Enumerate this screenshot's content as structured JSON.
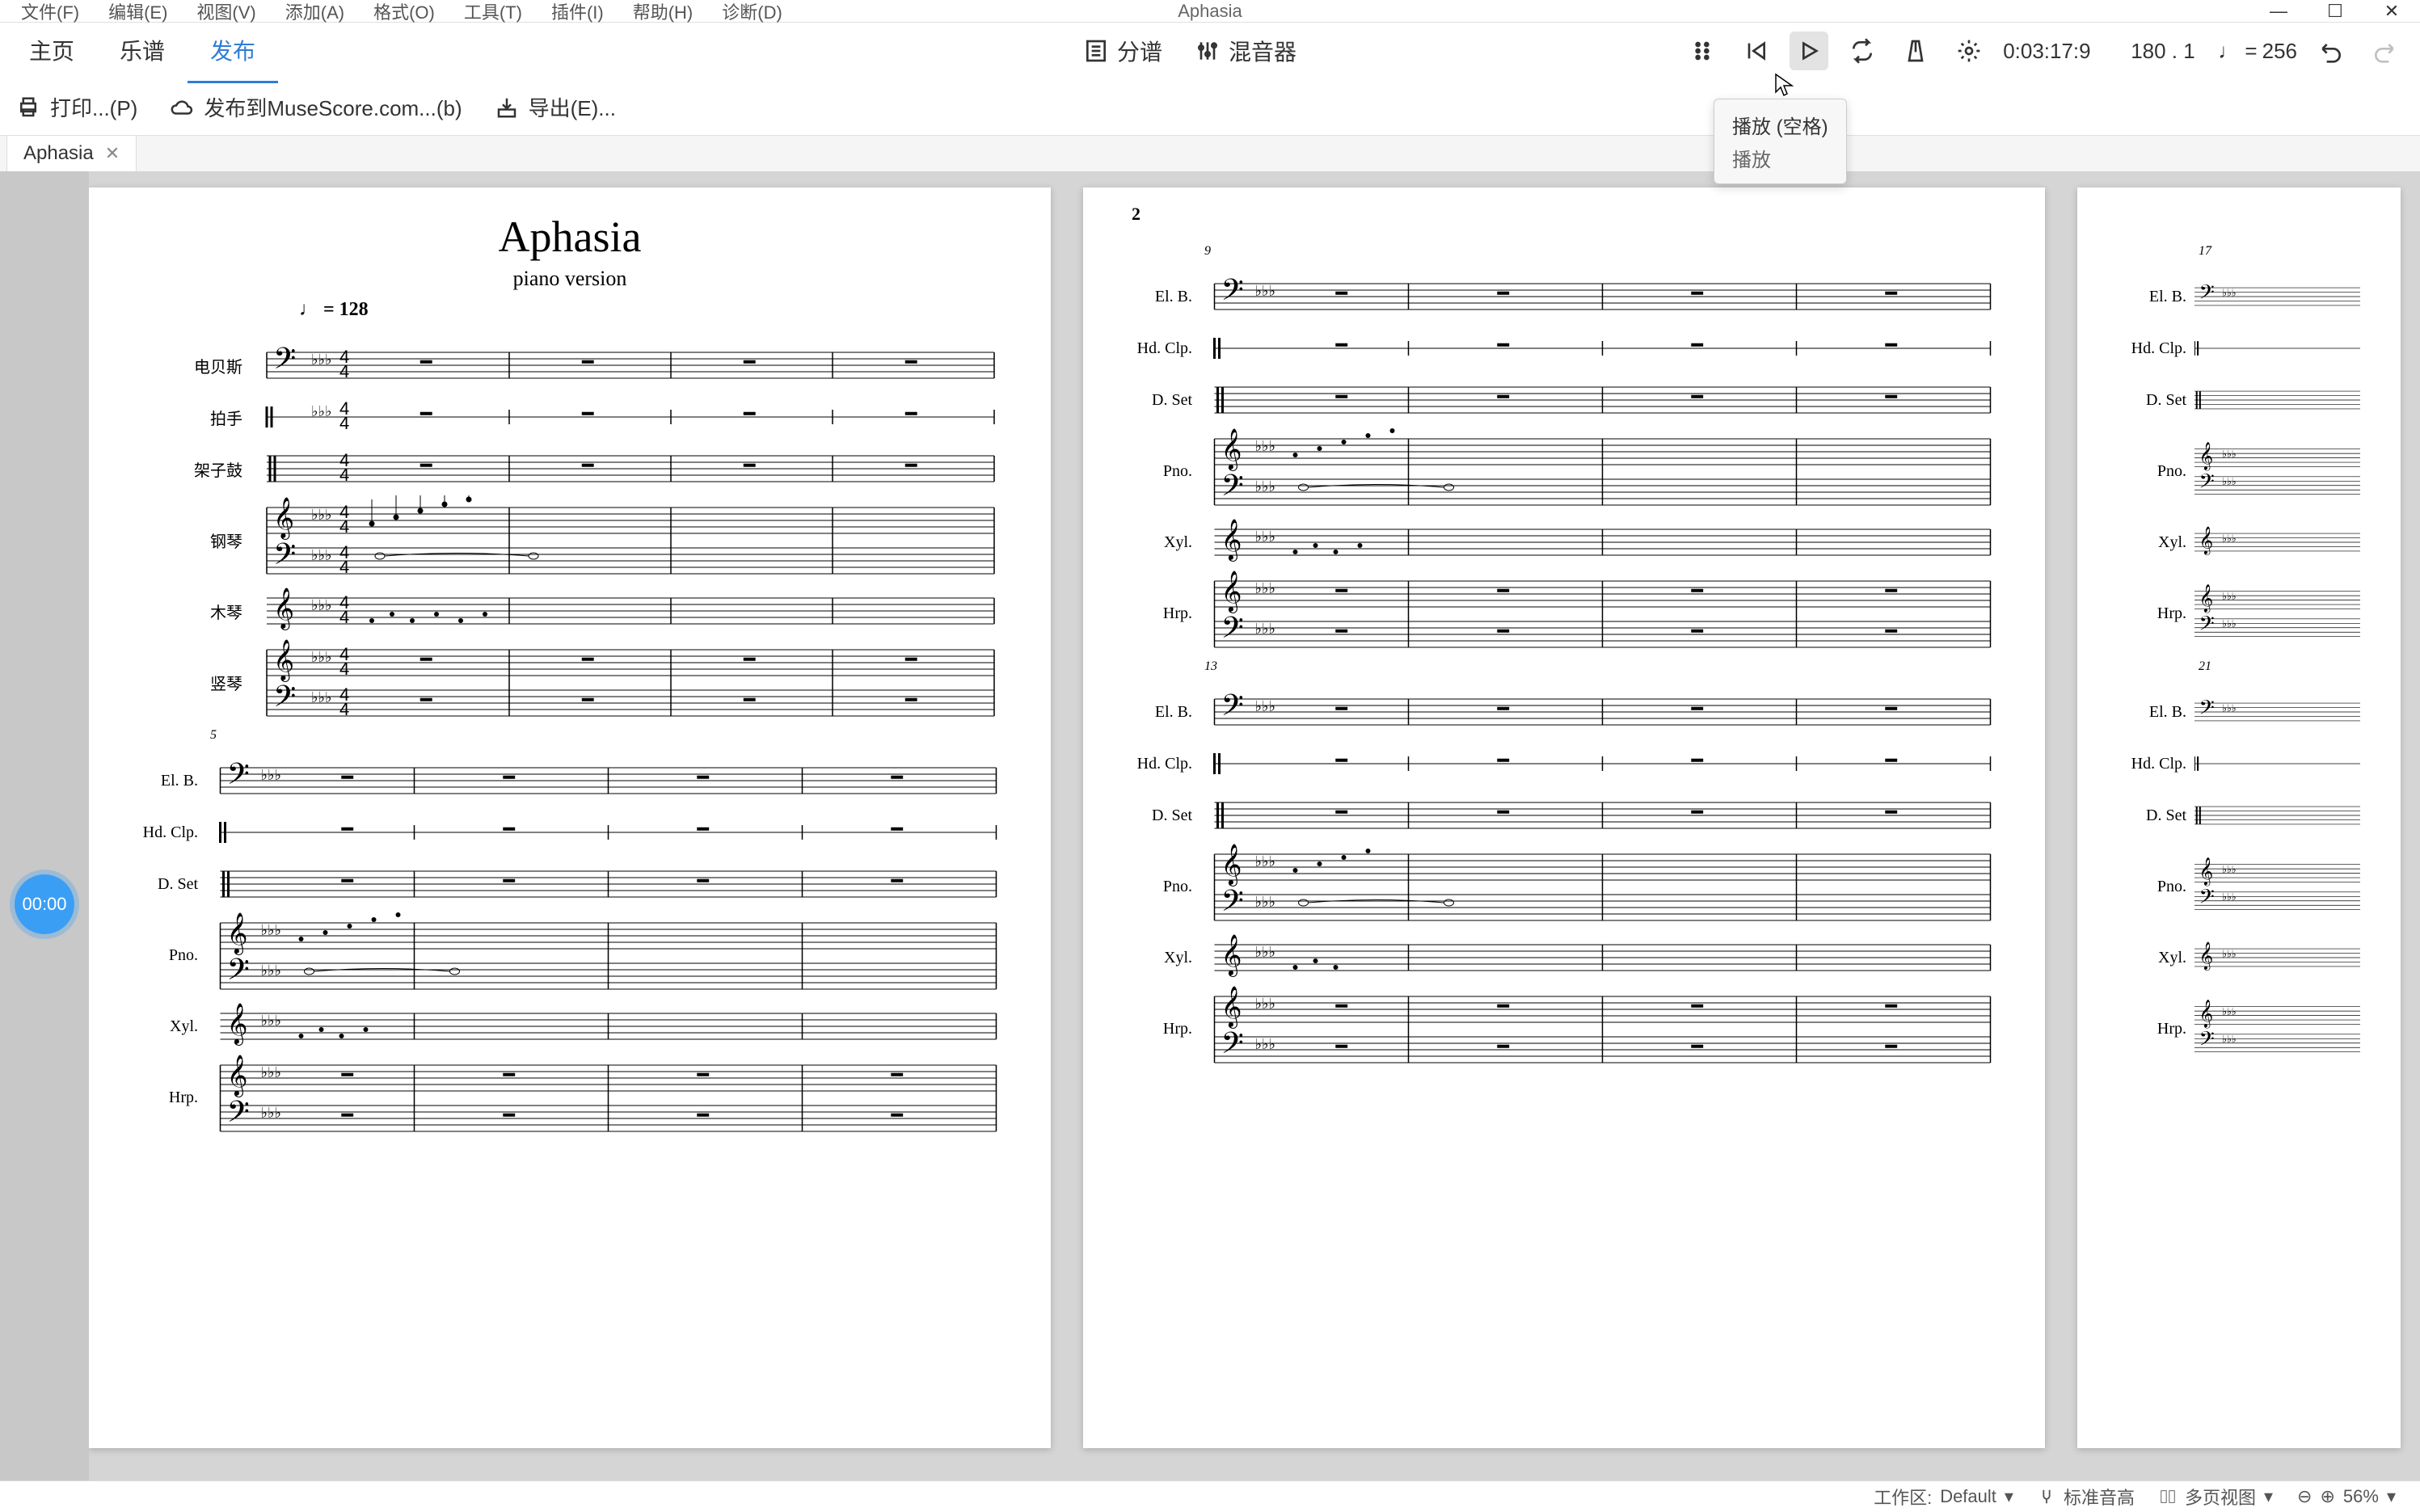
{
  "app_title": "Aphasia",
  "menubar": [
    "文件(F)",
    "编辑(E)",
    "视图(V)",
    "添加(A)",
    "格式(O)",
    "工具(T)",
    "插件(I)",
    "帮助(H)",
    "诊断(D)"
  ],
  "main_tabs": {
    "home": "主页",
    "score": "乐谱",
    "publish": "发布",
    "active": "publish"
  },
  "center_tools": {
    "parts": "分谱",
    "mixer": "混音器"
  },
  "playback": {
    "time": "0:03:17:9",
    "measure": "180 . 1",
    "tempo_value": "256",
    "tempo_prefix": "♩ = "
  },
  "toolbar": {
    "print": "打印...(P)",
    "publish": "发布到MuseScore.com...(b)",
    "export": "导出(E)..."
  },
  "tooltip": {
    "line1": "播放 (空格)",
    "line2": "播放"
  },
  "doctab": {
    "name": "Aphasia"
  },
  "timer_badge": "00:00",
  "score": {
    "title": "Aphasia",
    "subtitle": "piano version",
    "tempo_marking": "♩ = 128",
    "page1_instruments": [
      "电贝斯",
      "拍手",
      "架子鼓",
      "钢琴",
      "木琴",
      "竖琴"
    ],
    "short_labels": [
      "El. B.",
      "Hd. Clp.",
      "D. Set",
      "Pno.",
      "Xyl.",
      "Hrp."
    ],
    "page2_number": "2",
    "measure_numbers": {
      "sys2": "5",
      "p2_sys1": "9",
      "p2_sys2": "13",
      "p3_sys1": "17",
      "p3_sys2": "21"
    }
  },
  "statusbar": {
    "workspace_label": "工作区:",
    "workspace_value": "Default",
    "pitch": "标准音高",
    "view": "多页视图",
    "zoom": "56%"
  }
}
